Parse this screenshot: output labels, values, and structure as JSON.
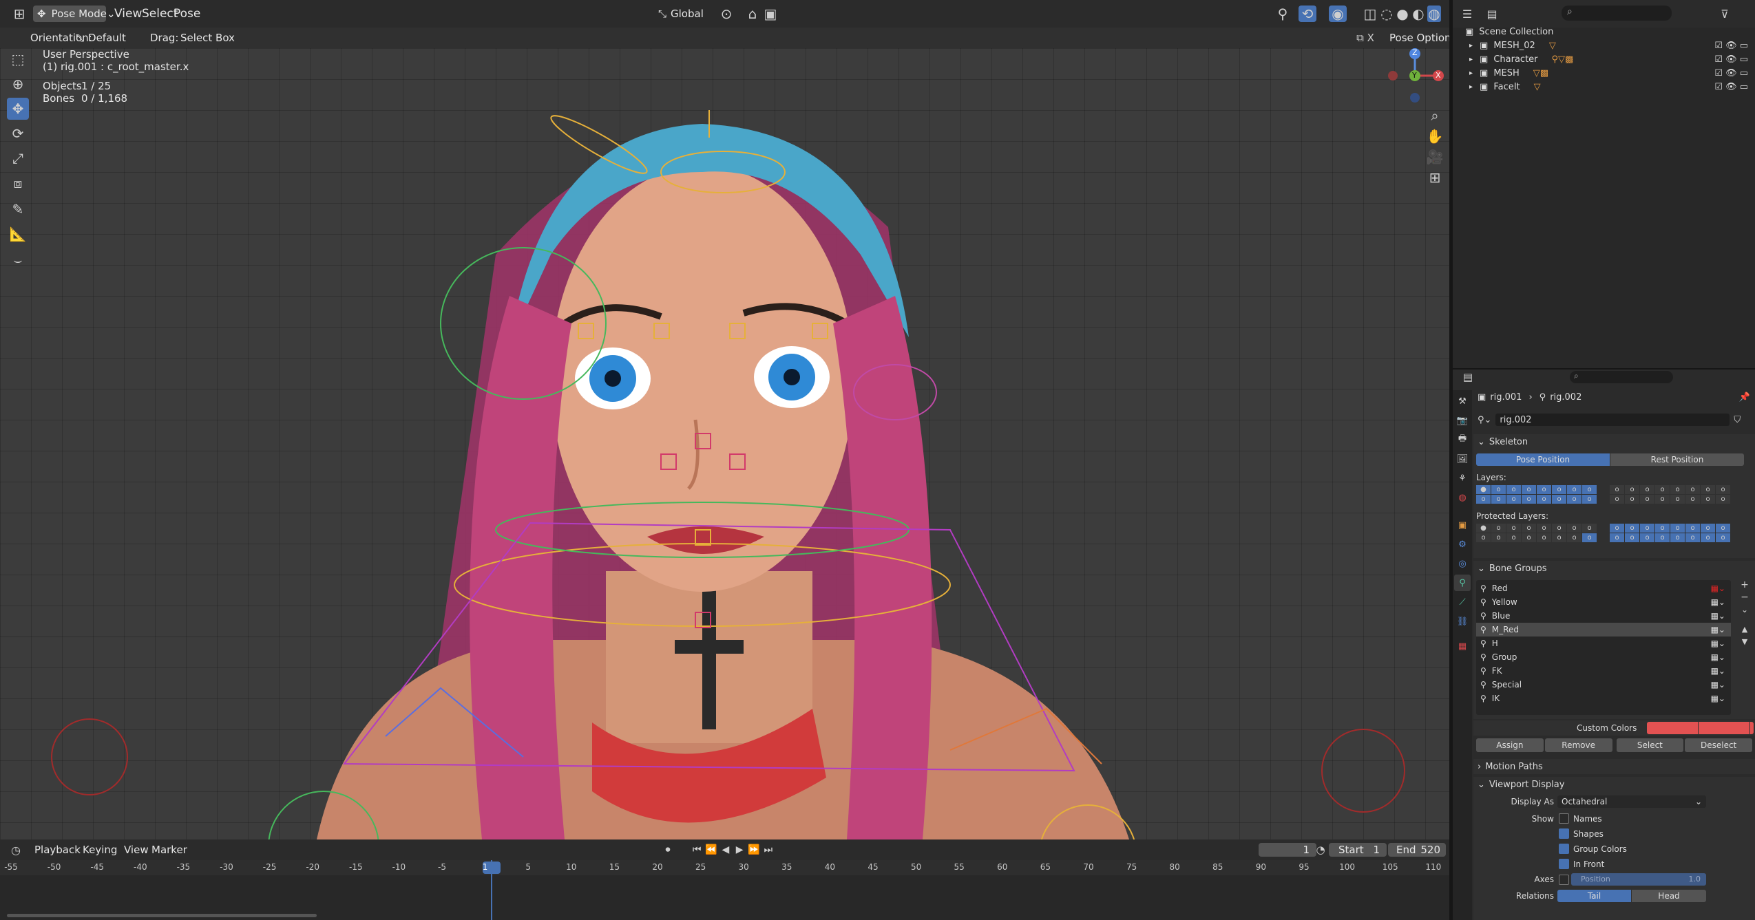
{
  "top_bar": {
    "mode": "Pose Mode",
    "menus": [
      "View",
      "Select",
      "Pose"
    ],
    "transform_orientation": "Global"
  },
  "tool_header": {
    "orientation_label": "Orientation:",
    "orientation_value": "Default",
    "drag_label": "Drag:",
    "drag_value": "Select Box",
    "pose_options": "Pose Options"
  },
  "viewport": {
    "view_name": "User Perspective",
    "active_object": "(1) rig.001 : c_root_master.x",
    "objects_label": "Objects",
    "objects_value": "1 / 25",
    "bones_label": "Bones",
    "bones_value": "0 / 1,168",
    "gizmo": {
      "z": "Z",
      "y": "Y",
      "x": "X"
    }
  },
  "outliner": {
    "scene_collection": "Scene Collection",
    "items": [
      {
        "label": "MESH_02"
      },
      {
        "label": "Character"
      },
      {
        "label": "MESH"
      },
      {
        "label": "FaceIt"
      }
    ]
  },
  "properties": {
    "breadcrumb": {
      "object": "rig.001",
      "data": "rig.002"
    },
    "datablock_name": "rig.002",
    "skeleton": {
      "title": "Skeleton",
      "pose_position": "Pose Position",
      "rest_position": "Rest Position",
      "layers_label": "Layers:",
      "protected_label": "Protected Layers:"
    },
    "bone_groups": {
      "title": "Bone Groups",
      "items": [
        "Red",
        "Yellow",
        "Blue",
        "M_Red",
        "H",
        "Group",
        "FK",
        "Special",
        "IK"
      ],
      "selected": "M_Red",
      "custom_colors_label": "Custom Colors",
      "assign": "Assign",
      "remove": "Remove",
      "select": "Select",
      "deselect": "Deselect"
    },
    "motion_paths": {
      "title": "Motion Paths"
    },
    "viewport_display": {
      "title": "Viewport Display",
      "display_as_label": "Display As",
      "display_as_value": "Octahedral",
      "show_label": "Show",
      "names": "Names",
      "shapes": "Shapes",
      "group_colors": "Group Colors",
      "in_front": "In Front",
      "axes_label": "Axes",
      "axes_position_label": "Position",
      "axes_position_value": "1.0",
      "relations_label": "Relations",
      "relations_tail": "Tail",
      "relations_head": "Head"
    }
  },
  "timeline": {
    "menus": [
      "Playback",
      "Keying",
      "View",
      "Marker"
    ],
    "current_frame": "1",
    "start_label": "Start",
    "start_value": "1",
    "end_label": "End",
    "end_value": "520",
    "ticks": [
      "-55",
      "-50",
      "-45",
      "-40",
      "-35",
      "-30",
      "-25",
      "-20",
      "-15",
      "-10",
      "-5",
      "1",
      "5",
      "10",
      "15",
      "20",
      "25",
      "30",
      "35",
      "40",
      "45",
      "50",
      "55",
      "60",
      "65",
      "70",
      "75",
      "80",
      "85",
      "90",
      "95",
      "100",
      "105",
      "110"
    ]
  },
  "colors": {
    "accent_blue": "#4772b3",
    "bone_red": "#e35252",
    "hair_blue": "#4aa6c9",
    "hair_pink": "#c0447a"
  }
}
